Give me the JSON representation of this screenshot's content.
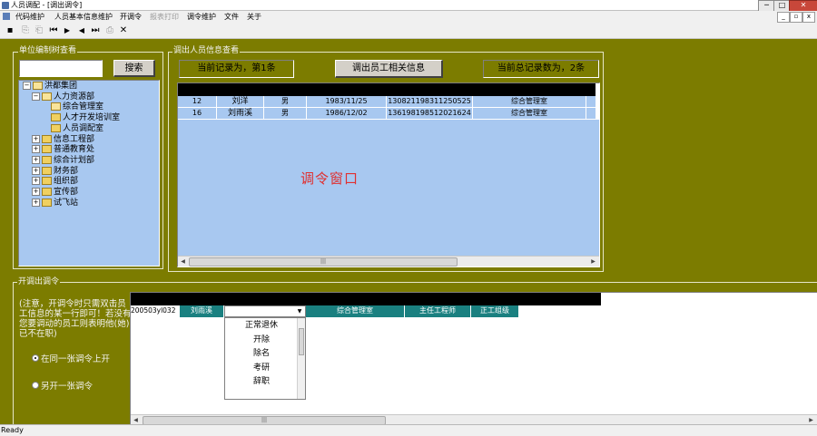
{
  "window": {
    "title": "人员调配 - [调出调令]",
    "controls": {
      "minimize": "─",
      "maximize": "□",
      "close": "✕"
    },
    "mdi_controls": {
      "minimize": "_",
      "restore": "▫",
      "close": "x"
    }
  },
  "menubar": {
    "items": [
      {
        "label": "代码维护",
        "enabled": true
      },
      {
        "label": "人员基本信息维护",
        "enabled": true
      },
      {
        "label": "开调令",
        "enabled": true
      },
      {
        "label": "报表打印",
        "enabled": false
      },
      {
        "label": "调令维护",
        "enabled": true
      },
      {
        "label": "文件",
        "enabled": true
      },
      {
        "label": "关于",
        "enabled": true
      }
    ]
  },
  "toolbar": {
    "icons": [
      {
        "name": "save-icon",
        "glyph": "▪",
        "enabled": true
      },
      {
        "name": "copy-record-icon",
        "glyph": "⎘",
        "enabled": false
      },
      {
        "name": "paste-record-icon",
        "glyph": "⎗",
        "enabled": false
      },
      {
        "name": "first-record-icon",
        "glyph": "⏮",
        "enabled": true
      },
      {
        "name": "next-record-icon",
        "glyph": "▶",
        "enabled": true
      },
      {
        "name": "prev-record-icon",
        "glyph": "◀",
        "enabled": true
      },
      {
        "name": "last-record-icon",
        "glyph": "⏭",
        "enabled": true
      },
      {
        "name": "print-icon",
        "glyph": "⎙",
        "enabled": false
      },
      {
        "name": "close-icon",
        "glyph": "✕",
        "enabled": true
      }
    ]
  },
  "org_tree_group": {
    "title": "单位编制树查看",
    "search_value": "",
    "search_button": "搜索",
    "nodes": [
      {
        "label": "洪都集团",
        "level": 0,
        "toggle": "−",
        "folder": "open"
      },
      {
        "label": "人力资源部",
        "level": 1,
        "toggle": "−",
        "folder": "open"
      },
      {
        "label": "综合管理室",
        "level": 2,
        "toggle": "",
        "folder": "open"
      },
      {
        "label": "人才开发培训室",
        "level": 2,
        "toggle": "",
        "folder": "closed"
      },
      {
        "label": "人员调配室",
        "level": 2,
        "toggle": "",
        "folder": "closed"
      },
      {
        "label": "信息工程部",
        "level": 1,
        "toggle": "+",
        "folder": "closed"
      },
      {
        "label": "普通教育处",
        "level": 1,
        "toggle": "+",
        "folder": "closed"
      },
      {
        "label": "综合计划部",
        "level": 1,
        "toggle": "+",
        "folder": "closed"
      },
      {
        "label": "财务部",
        "level": 1,
        "toggle": "+",
        "folder": "closed"
      },
      {
        "label": "组织部",
        "level": 1,
        "toggle": "+",
        "folder": "closed"
      },
      {
        "label": "宣传部",
        "level": 1,
        "toggle": "+",
        "folder": "closed"
      },
      {
        "label": "试飞站",
        "level": 1,
        "toggle": "+",
        "folder": "closed"
      }
    ]
  },
  "outgoing_group": {
    "title": "调出人员信息查看",
    "current_record": "当前记录为，第1条",
    "related_info_button": "调出员工相关信息",
    "total_records": "当前总记录数为，2条",
    "window_label": "调令窗口",
    "rows": [
      [
        "12",
        "刘洋",
        "男",
        "1983/11/25",
        "130821198311250525",
        "综合管理室"
      ],
      [
        "16",
        "刘雨溪",
        "男",
        "1986/12/02",
        "136198198512021624",
        "综合管理室"
      ]
    ],
    "scroll_thumb": "|||"
  },
  "order_group": {
    "title": "开调出调令",
    "note": "(注意，开调令时只需双击员工信息的某一行即可！若没有您要调动的员工则表明他(她)已不在职)",
    "radio_same": "在同一张调令上开",
    "radio_new": "另开一张调令",
    "row": [
      "200503yl032",
      "刘雨溪",
      "",
      "综合管理室",
      "主任工程师",
      "正工组级"
    ],
    "dropdown_value": "",
    "dropdown_arrow": "▼",
    "dropdown_options": [
      "正常退休",
      "开除",
      "除名",
      "考研",
      "辞职"
    ],
    "scroll_thumb": "|||"
  },
  "statusbar": {
    "text": "Ready"
  }
}
